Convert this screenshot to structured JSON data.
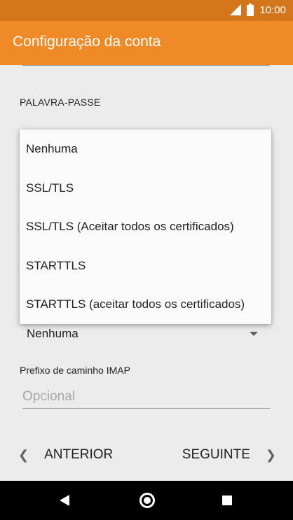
{
  "status_bar": {
    "time": "10:00",
    "icons": [
      "signal-icon",
      "battery-icon"
    ]
  },
  "app_bar": {
    "title": "Configuração da conta"
  },
  "form": {
    "password_label": "PALAVRA-PASSE",
    "security_selected": "Nenhuma",
    "prefix_label": "Prefixo de caminho IMAP",
    "prefix_placeholder": "Opcional",
    "prefix_value": ""
  },
  "dropdown": {
    "options": [
      "Nenhuma",
      "SSL/TLS",
      "SSL/TLS (Aceitar todos os certificados)",
      "STARTTLS",
      "STARTTLS (aceitar todos os certificados)"
    ]
  },
  "navigation": {
    "prev_label": "ANTERIOR",
    "next_label": "SEGUINTE"
  },
  "colors": {
    "app_bar": "#ef8a27",
    "status_bar": "#d3761b",
    "background": "#ebebeb",
    "system_nav": "#000000"
  }
}
